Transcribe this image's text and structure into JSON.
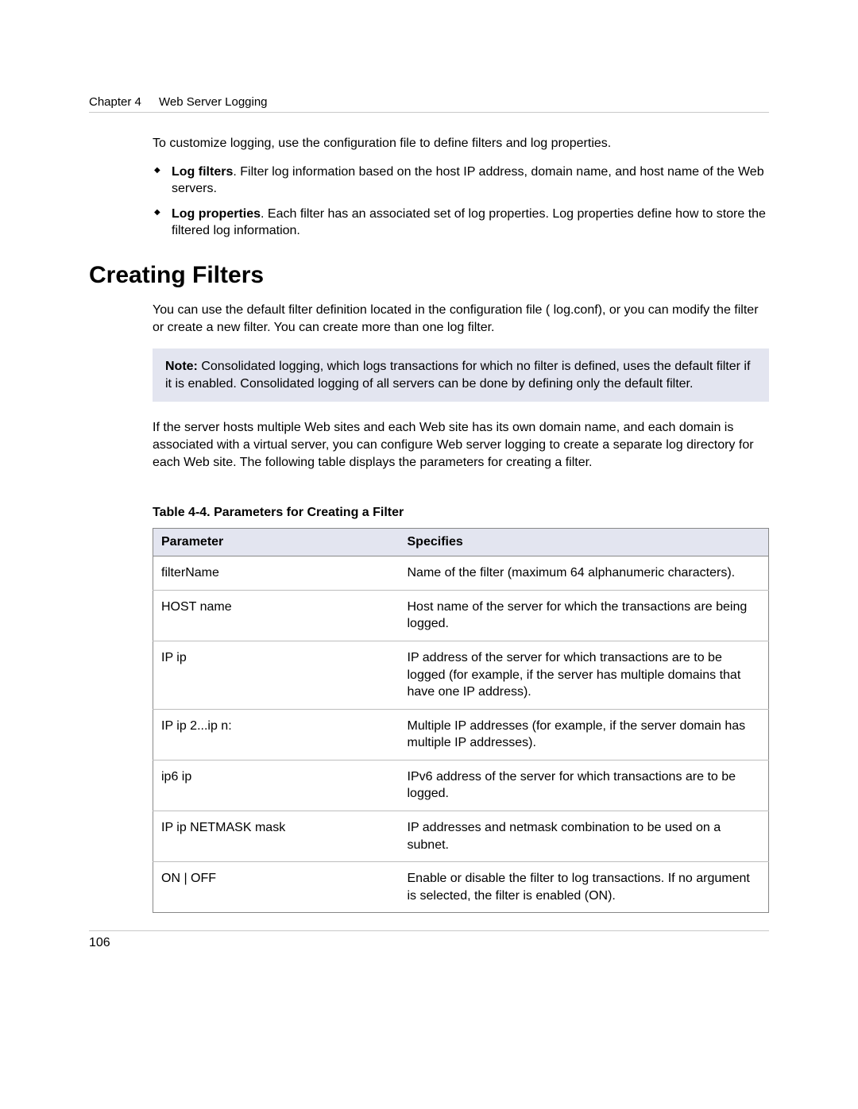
{
  "header": {
    "chapter_label": "Chapter 4",
    "chapter_title": "Web Server Logging"
  },
  "intro": "To customize logging, use the configuration file to define filters and log properties.",
  "bullets": [
    {
      "lead": "Log filters",
      "text": ". Filter log information based on the host IP address, domain name, and host name of the Web servers."
    },
    {
      "lead": "Log properties",
      "text": ". Each filter has an associated set of log properties. Log properties define how to store the filtered log information."
    }
  ],
  "section": {
    "title": "Creating Filters",
    "p1": "You can use the default filter definition located in the configuration file ( log.conf), or you can modify the filter or create a new filter. You can create more than one log filter.",
    "note_lead": "Note:",
    "note_text": "  Consolidated logging, which logs transactions for which no filter is defined, uses the default filter if it is enabled. Consolidated logging of all servers can be done by defining only the default filter.",
    "p2": "If the server hosts multiple Web sites and each Web site has its own domain name, and each domain is associated with a virtual server, you can configure Web server logging to create a separate log directory for each Web site. The following table displays the parameters for creating a filter."
  },
  "table": {
    "caption": "Table 4-4.  Parameters for Creating a Filter",
    "head_param": "Parameter",
    "head_spec": "Specifies",
    "rows": [
      {
        "param": "filterName",
        "spec": "Name of the filter (maximum 64 alphanumeric characters)."
      },
      {
        "param": "HOST name",
        "spec": "Host name of the server for which the transactions are being logged."
      },
      {
        "param": "IP ip",
        "spec": "IP address of the server for which transactions are to be logged (for example, if the server has multiple domains that have one IP address)."
      },
      {
        "param": "IP ip 2...ip n:",
        "spec": "Multiple IP addresses (for example, if the server domain has multiple IP addresses)."
      },
      {
        "param": "ip6 ip",
        "spec": "IPv6 address of the server for which transactions are to be logged."
      },
      {
        "param": "IP ip NETMASK mask",
        "spec": "IP addresses and netmask combination to be used on a subnet."
      },
      {
        "param": "ON | OFF",
        "spec": "Enable or disable the filter to log transactions. If no argument is selected, the filter is enabled (ON)."
      }
    ]
  },
  "page_number": "106"
}
